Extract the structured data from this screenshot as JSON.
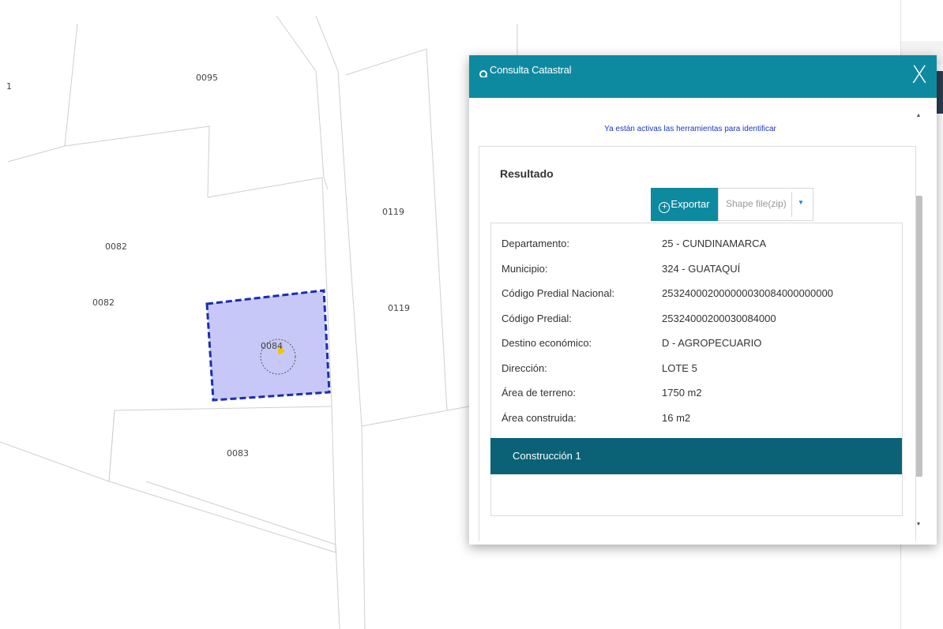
{
  "map": {
    "parcels": [
      "0095",
      "0119",
      "0082",
      "0082",
      "0119",
      "0084",
      "0083",
      "1"
    ]
  },
  "dialog": {
    "title": "Consulta Catastral",
    "close_label": "X",
    "notice": "Ya están activas las herramientas para identificar",
    "scroll_up": "▲",
    "scroll_down": "▼",
    "result": {
      "title": "Resultado",
      "export_label": "Exportar",
      "format_value": "Shape file(zip)",
      "rows": [
        {
          "key": "Departamento:",
          "value": "25 - CUNDINAMARCA"
        },
        {
          "key": "Municipio:",
          "value": "324 - GUATAQUÍ"
        },
        {
          "key": "Código Predial Nacional:",
          "value": "253240002000000030084000000000"
        },
        {
          "key": "Código Predial:",
          "value": "25324000200030084000"
        },
        {
          "key": "Destino económico:",
          "value": "D - AGROPECUARIO"
        },
        {
          "key": "Dirección:",
          "value": "LOTE 5"
        },
        {
          "key": "Área de terreno:",
          "value": "1750 m2"
        },
        {
          "key": "Área construida:",
          "value": "16 m2"
        }
      ],
      "construction_label": "Construcción 1"
    }
  },
  "colors": {
    "header": "#0e8aa0",
    "construction_bar": "#0b6276",
    "selection_fill": "#c8c8f8",
    "selection_stroke": "#1a2db3"
  }
}
